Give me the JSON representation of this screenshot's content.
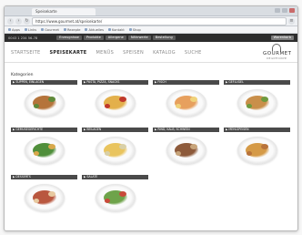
{
  "browser": {
    "tab_title": "Speisekarte",
    "url": "https://www.gourmet.at/speisekarte/",
    "back_glyph": "‹",
    "forward_glyph": "›",
    "reload_glyph": "↻",
    "bookmarks": [
      "Apps",
      "Links",
      "Gourmet",
      "Rezepte",
      "Aktuelles",
      "Kontakt",
      "Shop"
    ]
  },
  "site": {
    "hotline": "0043 1 234 56-78",
    "top_links": [
      "Erzeugnisse",
      "Produkte",
      "Allergene",
      "Nährwerte",
      "Bestellung"
    ],
    "cart_label": "Warenkorb",
    "nav": {
      "items": [
        "STARTSEITE",
        "SPEISEKARTE",
        "MENÜS",
        "SPEISEN",
        "KATALOG",
        "SUCHE"
      ],
      "active_index": 1
    },
    "logo": {
      "name": "GOURMET",
      "tagline": "DIE GUTE KÜCHE"
    },
    "page_title": "Kategorien"
  },
  "categories": [
    {
      "label": "SUPPEN, EINLAGEN",
      "food": "#b5743b",
      "accent": "#5f8a3a"
    },
    {
      "label": "PASTA, PIZZA, SNACKS",
      "food": "#e3b04b",
      "accent": "#c0392b"
    },
    {
      "label": "FISCH",
      "food": "#e7a05e",
      "accent": "#f0d27a"
    },
    {
      "label": "GEFLÜGEL",
      "food": "#c98f4a",
      "accent": "#6e9a3e"
    },
    {
      "label": "GEMÜSEGERICHTE",
      "food": "#4f8e3a",
      "accent": "#d8a84b"
    },
    {
      "label": "BEILAGEN",
      "food": "#e9c45e",
      "accent": "#d9d0a8"
    },
    {
      "label": "RIND, KALB, SCHWEIN",
      "food": "#8d5a3b",
      "accent": "#c7a47a"
    },
    {
      "label": "MEHLSPEISEN",
      "food": "#d59a47",
      "accent": "#b8733a"
    },
    {
      "label": "DESSERTS",
      "food": "#b9573f",
      "accent": "#e7c9a0"
    },
    {
      "label": "SALATE",
      "food": "#6ea34a",
      "accent": "#c94a3a"
    }
  ]
}
